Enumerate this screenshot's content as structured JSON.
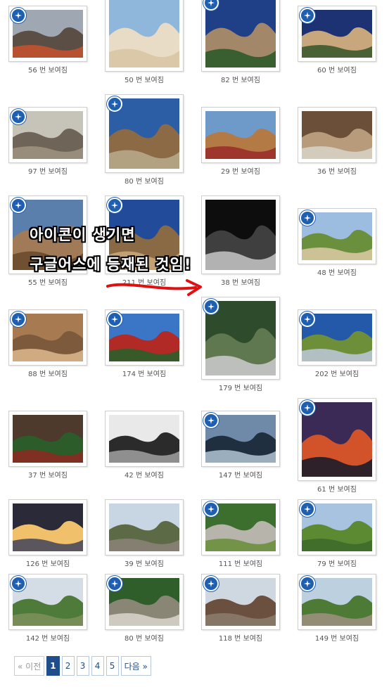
{
  "gallery": {
    "items": [
      {
        "caption": "56 번 보여짐",
        "badge": true,
        "palette": [
          "#9fa7b2",
          "#5a4e45",
          "#c2522e"
        ]
      },
      {
        "caption": "50 번 보여짐",
        "badge": false,
        "palette": [
          "#8fb7dc",
          "#e8dcc6",
          "#d9c5a4"
        ]
      },
      {
        "caption": "82 번 보여짐",
        "badge": true,
        "palette": [
          "#1f3f86",
          "#a28768",
          "#2d5b2a"
        ]
      },
      {
        "caption": "60 번 보여짐",
        "badge": true,
        "palette": [
          "#1c3272",
          "#c9a77d",
          "#3c5a2e"
        ]
      },
      {
        "caption": "97 번 보여짐",
        "badge": true,
        "palette": [
          "#c6c3b9",
          "#6e6457",
          "#9c917f"
        ]
      },
      {
        "caption": "80 번 보여짐",
        "badge": true,
        "palette": [
          "#2c5ea5",
          "#8b6a45",
          "#b7a888"
        ]
      },
      {
        "caption": "29 번 보여짐",
        "badge": false,
        "palette": [
          "#6e9ac9",
          "#b47a45",
          "#9c2f2a"
        ]
      },
      {
        "caption": "36 번 보여짐",
        "badge": false,
        "palette": [
          "#6c4f38",
          "#b79b7a",
          "#d6d0c2"
        ]
      },
      {
        "caption": "55 번 보여짐",
        "badge": true,
        "palette": [
          "#5a7fad",
          "#a17b57",
          "#6b4a2e"
        ]
      },
      {
        "caption": "211 번 보여짐",
        "badge": true,
        "palette": [
          "#224c9a",
          "#8a6a44",
          "#c6a77a"
        ]
      },
      {
        "caption": "38 번 보여짐",
        "badge": false,
        "palette": [
          "#0d0d0d",
          "#3f3f3f",
          "#bfbfbf"
        ]
      },
      {
        "caption": "48 번 보여짐",
        "badge": true,
        "palette": [
          "#9dbde0",
          "#6a8f3d",
          "#d8c8a0"
        ]
      },
      {
        "caption": "88 번 보여짐",
        "badge": true,
        "palette": [
          "#a77a52",
          "#7d5a3c",
          "#d9b287"
        ]
      },
      {
        "caption": "174 번 보여짐",
        "badge": true,
        "palette": [
          "#3b76c6",
          "#b22a26",
          "#2a5e29"
        ]
      },
      {
        "caption": "179 번 보여짐",
        "badge": true,
        "palette": [
          "#2e4b2c",
          "#5f7850",
          "#c6c6c6"
        ]
      },
      {
        "caption": "202 번 보여짐",
        "badge": true,
        "palette": [
          "#2458a8",
          "#6e8f3a",
          "#b9c4d3"
        ]
      },
      {
        "caption": "37 번 보여짐",
        "badge": false,
        "palette": [
          "#4d3a2c",
          "#2c5c2a",
          "#8a2a22"
        ]
      },
      {
        "caption": "42 번 보여짐",
        "badge": false,
        "palette": [
          "#e9e9e9",
          "#2b2b2b",
          "#9a9a9a"
        ]
      },
      {
        "caption": "147 번 보여짐",
        "badge": true,
        "palette": [
          "#6e8aa8",
          "#1f2f3f",
          "#a9bccc"
        ]
      },
      {
        "caption": "61 번 보여짐",
        "badge": true,
        "palette": [
          "#3b2a55",
          "#d2532a",
          "#1c1c2a"
        ]
      },
      {
        "caption": "126 번 보여짐",
        "badge": false,
        "palette": [
          "#2a2a38",
          "#f0c06a",
          "#4a4a5c"
        ]
      },
      {
        "caption": "39 번 보여짐",
        "badge": false,
        "palette": [
          "#c8d6e4",
          "#5c6b45",
          "#8a8275"
        ]
      },
      {
        "caption": "111 번 보여짐",
        "badge": true,
        "palette": [
          "#3c6e2e",
          "#b7b4ac",
          "#6a8f3d"
        ]
      },
      {
        "caption": "79 번 보여짐",
        "badge": true,
        "palette": [
          "#a7c3e0",
          "#5b8a33",
          "#3e6a29"
        ]
      },
      {
        "caption": "142 번 보여짐",
        "badge": true,
        "palette": [
          "#d4dde6",
          "#4e7a3a",
          "#7b8f5b"
        ]
      },
      {
        "caption": "80 번 보여짐",
        "badge": true,
        "palette": [
          "#2f5e2a",
          "#8a8676",
          "#d5d2c8"
        ]
      },
      {
        "caption": "118 번 보여짐",
        "badge": true,
        "palette": [
          "#cfd8e0",
          "#6b5040",
          "#8a7a6a"
        ]
      },
      {
        "caption": "149 번 보여짐",
        "badge": true,
        "palette": [
          "#bcd0e0",
          "#4d7a35",
          "#9b8f7c"
        ]
      }
    ]
  },
  "annotation": {
    "line1": "아이콘이 생기면",
    "line2": "구글어스에 등재된 것임!",
    "arrow_color": "#e01010"
  },
  "pagination": {
    "prev": "« 이전",
    "pages": [
      "1",
      "2",
      "3",
      "4",
      "5"
    ],
    "current": "1",
    "next": "다음 »"
  },
  "colors": {
    "badge": "#1f5fb2",
    "active_page": "#1f4e8c"
  }
}
